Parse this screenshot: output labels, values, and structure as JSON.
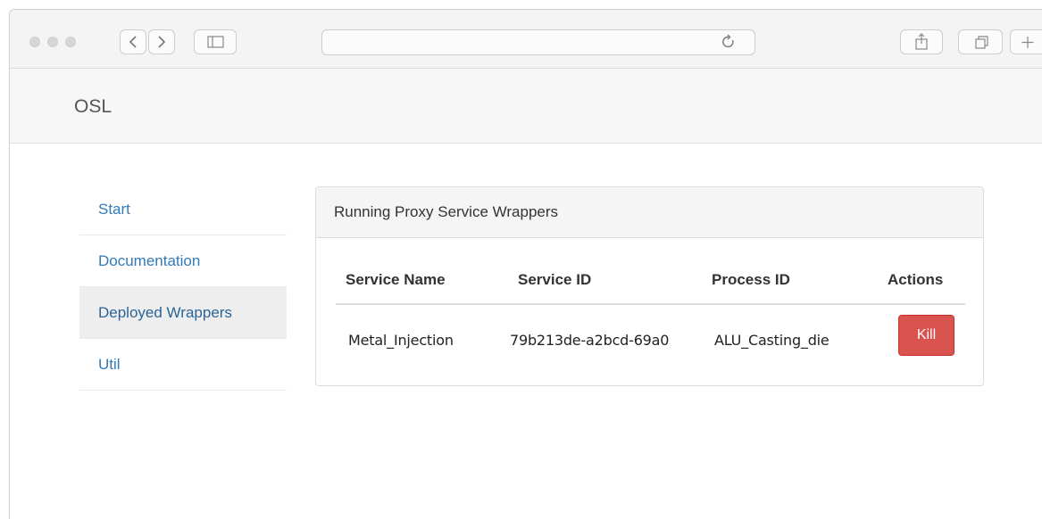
{
  "header": {
    "brand": "OSL"
  },
  "sidebar": {
    "items": [
      {
        "label": "Start"
      },
      {
        "label": "Documentation"
      },
      {
        "label": "Deployed Wrappers"
      },
      {
        "label": "Util"
      }
    ]
  },
  "panel": {
    "title": "Running Proxy Service Wrappers",
    "columns": [
      "Service Name",
      "Service ID",
      "Process ID",
      "Actions"
    ],
    "rows": [
      {
        "service_name": "Metal_Injection",
        "service_id": "79b213de-a2bcd-69a0",
        "process_id": "ALU_Casting_die",
        "action_label": "Kill"
      }
    ]
  },
  "colors": {
    "accent": "#337ab7",
    "danger": "#d9534f"
  }
}
